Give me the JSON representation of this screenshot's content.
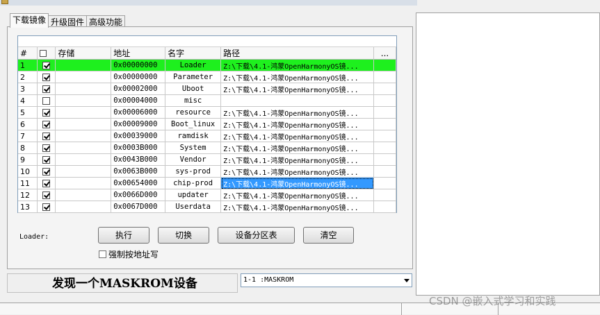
{
  "tabs": [
    "下载镜像",
    "升级固件",
    "高级功能"
  ],
  "table": {
    "headers": [
      "#",
      "",
      "存储",
      "地址",
      "名字",
      "路径",
      "..."
    ],
    "rows": [
      {
        "num": "1",
        "checked": true,
        "storage": "",
        "address": "0x00000000",
        "name": "Loader",
        "path": "Z:\\下载\\4.1-鸿蒙OpenHarmonyOS镜..."
      },
      {
        "num": "2",
        "checked": true,
        "storage": "",
        "address": "0x00000000",
        "name": "Parameter",
        "path": "Z:\\下载\\4.1-鸿蒙OpenHarmonyOS镜..."
      },
      {
        "num": "3",
        "checked": true,
        "storage": "",
        "address": "0x00002000",
        "name": "Uboot",
        "path": "Z:\\下载\\4.1-鸿蒙OpenHarmonyOS镜..."
      },
      {
        "num": "4",
        "checked": false,
        "storage": "",
        "address": "0x00004000",
        "name": "misc",
        "path": ""
      },
      {
        "num": "5",
        "checked": true,
        "storage": "",
        "address": "0x00006000",
        "name": "resource",
        "path": "Z:\\下载\\4.1-鸿蒙OpenHarmonyOS镜..."
      },
      {
        "num": "6",
        "checked": true,
        "storage": "",
        "address": "0x00009000",
        "name": "Boot_linux",
        "path": "Z:\\下载\\4.1-鸿蒙OpenHarmonyOS镜..."
      },
      {
        "num": "7",
        "checked": true,
        "storage": "",
        "address": "0x00039000",
        "name": "ramdisk",
        "path": "Z:\\下载\\4.1-鸿蒙OpenHarmonyOS镜..."
      },
      {
        "num": "8",
        "checked": true,
        "storage": "",
        "address": "0x0003B000",
        "name": "System",
        "path": "Z:\\下载\\4.1-鸿蒙OpenHarmonyOS镜..."
      },
      {
        "num": "9",
        "checked": true,
        "storage": "",
        "address": "0x0043B000",
        "name": "Vendor",
        "path": "Z:\\下载\\4.1-鸿蒙OpenHarmonyOS镜..."
      },
      {
        "num": "10",
        "checked": true,
        "storage": "",
        "address": "0x0063B000",
        "name": "sys-prod",
        "path": "Z:\\下载\\4.1-鸿蒙OpenHarmonyOS镜..."
      },
      {
        "num": "11",
        "checked": true,
        "storage": "",
        "address": "0x00654000",
        "name": "chip-prod",
        "path": "Z:\\下载\\4.1-鸿蒙OpenHarmonyOS镜..."
      },
      {
        "num": "12",
        "checked": true,
        "storage": "",
        "address": "0x0066D000",
        "name": "updater",
        "path": "Z:\\下载\\4.1-鸿蒙OpenHarmonyOS镜..."
      },
      {
        "num": "13",
        "checked": true,
        "storage": "",
        "address": "0x0067D000",
        "name": "Userdata",
        "path": "Z:\\下载\\4.1-鸿蒙OpenHarmonyOS镜..."
      }
    ],
    "highlight_row": 0,
    "selected_cell_row": 10,
    "highlight_color": "#1ef01e",
    "selection_color": "#3399ff"
  },
  "loader_label": "Loader:",
  "buttons": {
    "execute": "执行",
    "switch": "切换",
    "partition_table": "设备分区表",
    "clear": "清空"
  },
  "force_address_label": "强制按地址写",
  "status_message": "发现一个MASKROM设备",
  "device_select": "1-1 :MASKROM",
  "watermark": "CSDN @嵌入式学习和实践"
}
